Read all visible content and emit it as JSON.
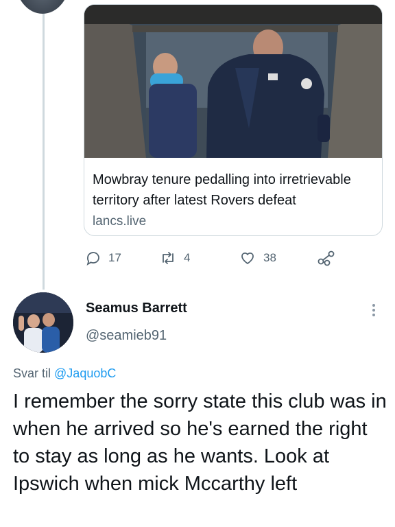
{
  "link_card": {
    "title": "Mowbray tenure pedalling into irretrievable territory after latest Rovers defeat",
    "domain": "lancs.live"
  },
  "actions": {
    "reply_count": "17",
    "retweet_count": "4",
    "like_count": "38"
  },
  "reply": {
    "author_name": "Seamus Barrett",
    "author_handle": "@seamieb91",
    "reply_label": "Svar til",
    "reply_to_handle": "@JaquobC",
    "text": "I remember the sorry state this club was in when he arrived so he's earned the right to stay as long as he wants. Look at Ipswich when mick Mccarthy left"
  },
  "colors": {
    "accent": "#1d9bf0",
    "secondary_text": "#536471",
    "border": "#cfd9de"
  },
  "icons": [
    "reply-icon",
    "retweet-icon",
    "like-icon",
    "share-icon",
    "more-icon"
  ]
}
